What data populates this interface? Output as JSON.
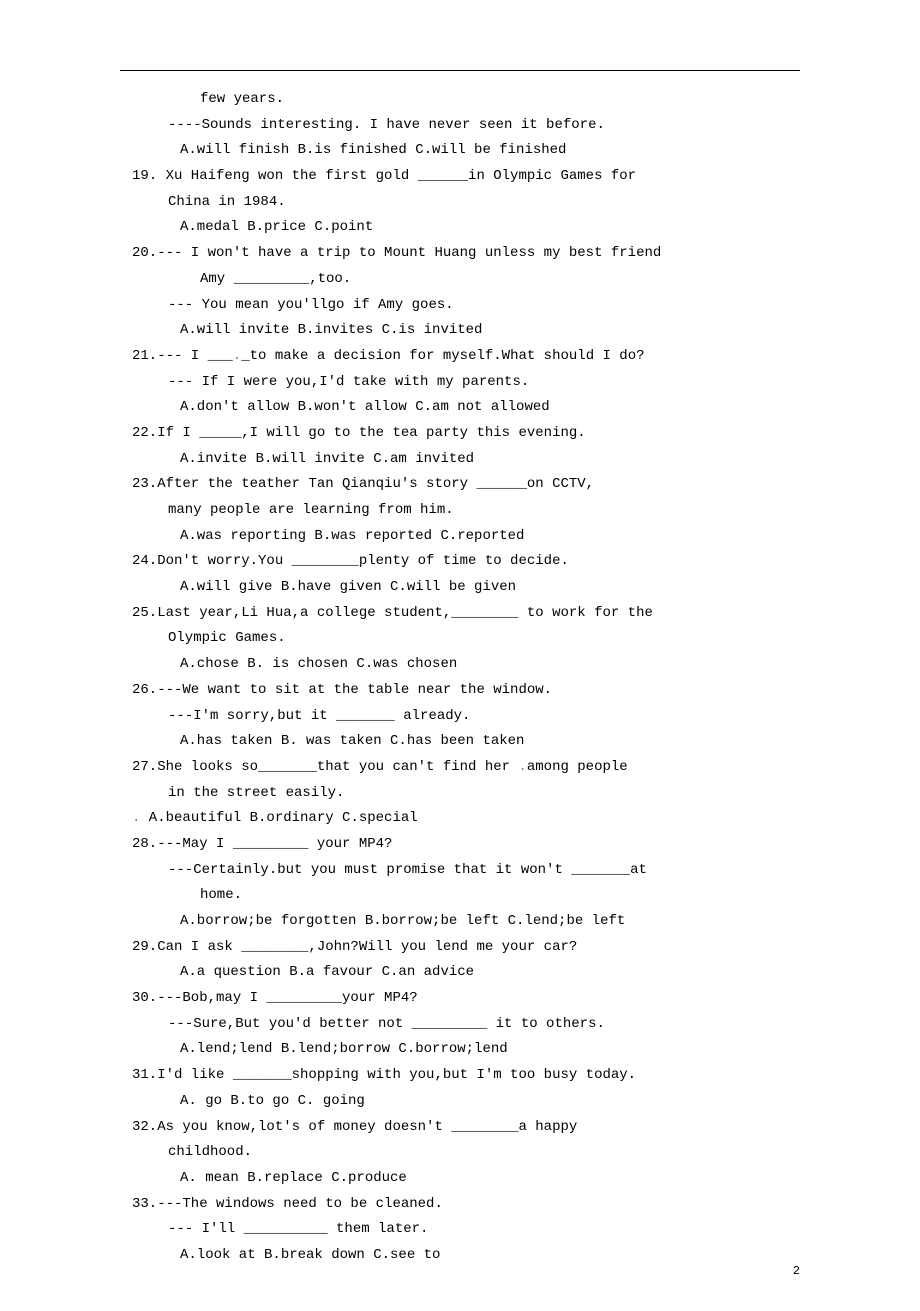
{
  "pageNumber": "2",
  "items": [
    {
      "type": "cont",
      "text": "few years."
    },
    {
      "type": "dialog",
      "text": "----Sounds interesting. I have never seen it before."
    },
    {
      "type": "opts",
      "text": "A.will finish    B.is finished       C.will be finished"
    },
    {
      "type": "q",
      "text": "19. Xu Haifeng won the first gold ______in Olympic Games for"
    },
    {
      "type": "dialog",
      "text": "China in 1984."
    },
    {
      "type": "opts",
      "text": "A.medal         B.price     C.point"
    },
    {
      "type": "q",
      "text": "20.--- I won't have a trip to Mount Huang unless my best friend"
    },
    {
      "type": "cont",
      "text": "Amy _________,too."
    },
    {
      "type": "dialog",
      "text": "--- You mean you'llgo if Amy goes."
    },
    {
      "type": "opts",
      "text": "A.will invite       B.invites      C.is invited"
    },
    {
      "type": "q-inline",
      "prefix": "21.--- I ___",
      "dot": ".",
      "suffix": "_to make a decision for myself.What should I do?"
    },
    {
      "type": "dialog",
      "text": "--- If I were you,I'd take with my parents."
    },
    {
      "type": "opts",
      "text": "A.don't allow    B.won't allow  C.am not allowed"
    },
    {
      "type": "q",
      "text": "22.If I _____,I will go to the tea party this evening."
    },
    {
      "type": "opts",
      "text": "A.invite     B.will invite     C.am invited"
    },
    {
      "type": "q",
      "text": "23.After the teather Tan Qianqiu's story ______on CCTV,"
    },
    {
      "type": "dialog",
      "text": "many people are learning from him."
    },
    {
      "type": "opts",
      "text": "A.was reporting        B.was reported         C.reported"
    },
    {
      "type": "q",
      "text": "24.Don't worry.You ________plenty of time to decide."
    },
    {
      "type": "opts",
      "text": "A.will give    B.have given   C.will be given"
    },
    {
      "type": "q",
      "text": "25.Last year,Li Hua,a college student,________ to work for the"
    },
    {
      "type": "dialog",
      "text": "Olympic Games."
    },
    {
      "type": "opts",
      "text": "A.chose       B. is chosen    C.was chosen"
    },
    {
      "type": "q",
      "text": "26.---We want to sit at the table near the window."
    },
    {
      "type": "dialog",
      "text": "---I'm sorry,but it _______ already."
    },
    {
      "type": "opts",
      "text": "A.has taken    B. was taken    C.has been taken"
    },
    {
      "type": "q-inline",
      "prefix": "27.She looks so_______that you can't find her ",
      "dot": ".",
      "suffix": "among people"
    },
    {
      "type": "dialog",
      "text": "in the street easily."
    },
    {
      "type": "opts-inline",
      "prefix": "",
      "dot": ".",
      "suffix": "  A.beautiful    B.ordinary     C.special"
    },
    {
      "type": "q",
      "text": "28.---May I _________ your MP4?"
    },
    {
      "type": "dialog",
      "text": "---Certainly.but you must promise that it won't _______at"
    },
    {
      "type": "cont",
      "text": "home."
    },
    {
      "type": "opts",
      "text": "A.borrow;be forgotten      B.borrow;be left      C.lend;be left"
    },
    {
      "type": "q",
      "text": "29.Can I ask ________,John?Will you lend me your car?"
    },
    {
      "type": "opts",
      "text": "A.a question      B.a favour     C.an advice"
    },
    {
      "type": "q",
      "text": "30.---Bob,may I _________your MP4?"
    },
    {
      "type": "dialog",
      "text": "---Sure,But you'd better not _________ it to others."
    },
    {
      "type": "opts",
      "text": "A.lend;lend    B.lend;borrow   C.borrow;lend"
    },
    {
      "type": "q",
      "text": "31.I'd like _______shopping with you,but I'm too busy today."
    },
    {
      "type": "opts",
      "text": "A. go      B.to go         C. going"
    },
    {
      "type": "q",
      "text": "32.As you know,lot's of money doesn't ________a happy"
    },
    {
      "type": "dialog",
      "text": "childhood."
    },
    {
      "type": "opts",
      "text": "A. mean            B.replace          C.produce"
    },
    {
      "type": "q",
      "text": "33.---The windows need to be cleaned."
    },
    {
      "type": "dialog",
      "text": "--- I'll __________ them later."
    },
    {
      "type": "opts",
      "text": "A.look at              B.break down         C.see to"
    }
  ]
}
